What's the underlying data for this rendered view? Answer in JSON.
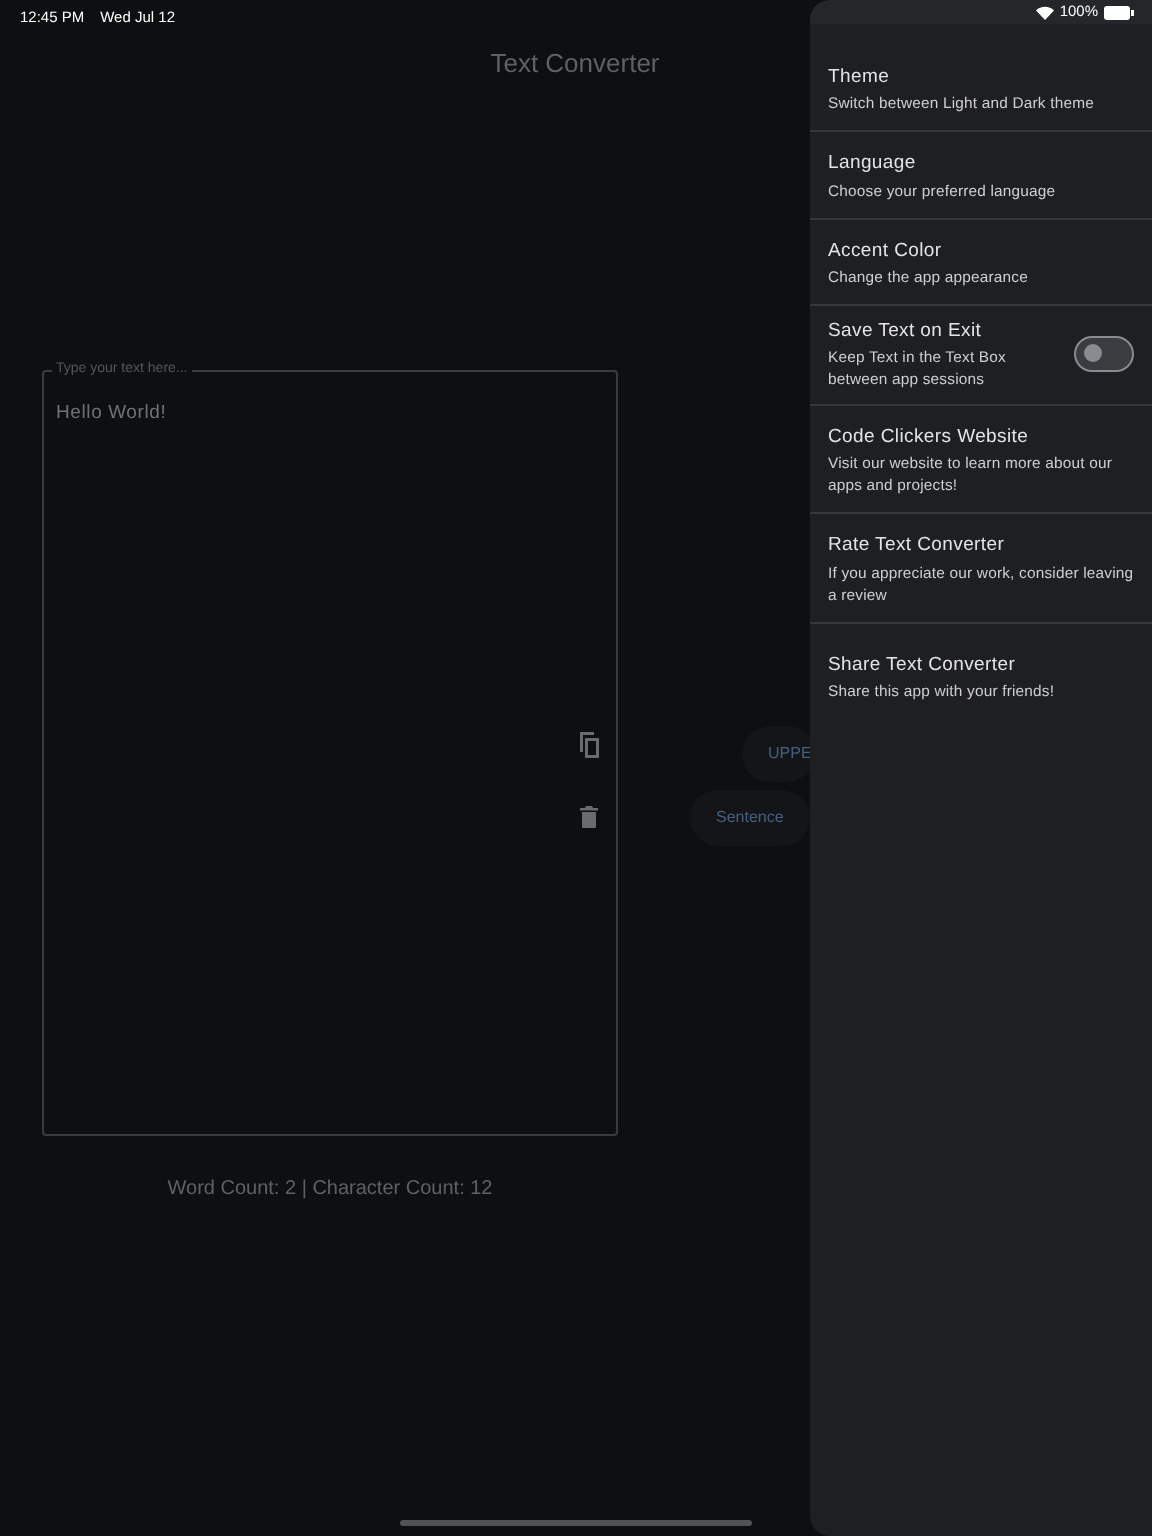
{
  "status_bar": {
    "time": "12:45 PM",
    "date": "Wed Jul 12",
    "battery": "100%"
  },
  "title": "Text Converter",
  "editor": {
    "placeholder": "Type your text here...",
    "value": "Hello World!"
  },
  "conversion_buttons": [
    "UPPE",
    "Sentence"
  ],
  "counts": "Word Count: 2 | Character Count: 12",
  "settings": [
    {
      "kind": "link",
      "title": "Theme",
      "subtitle": "Switch between Light and Dark theme"
    },
    {
      "kind": "link",
      "title": "Language",
      "subtitle": "Choose your preferred language"
    },
    {
      "kind": "link",
      "title": "Accent Color",
      "subtitle": "Change the app appearance"
    },
    {
      "kind": "toggle",
      "title": "Save Text on Exit",
      "subtitle": "Keep Text in the Text Box between app sessions",
      "on": false
    },
    {
      "kind": "link",
      "title": "Code Clickers Website",
      "subtitle": "Visit our website to learn more about our apps and projects!"
    },
    {
      "kind": "link",
      "title": "Rate Text Converter",
      "subtitle": "If you appreciate our work, consider leaving a review"
    },
    {
      "kind": "link",
      "title": "Share Text Converter",
      "subtitle": "Share this app with your friends!"
    }
  ]
}
